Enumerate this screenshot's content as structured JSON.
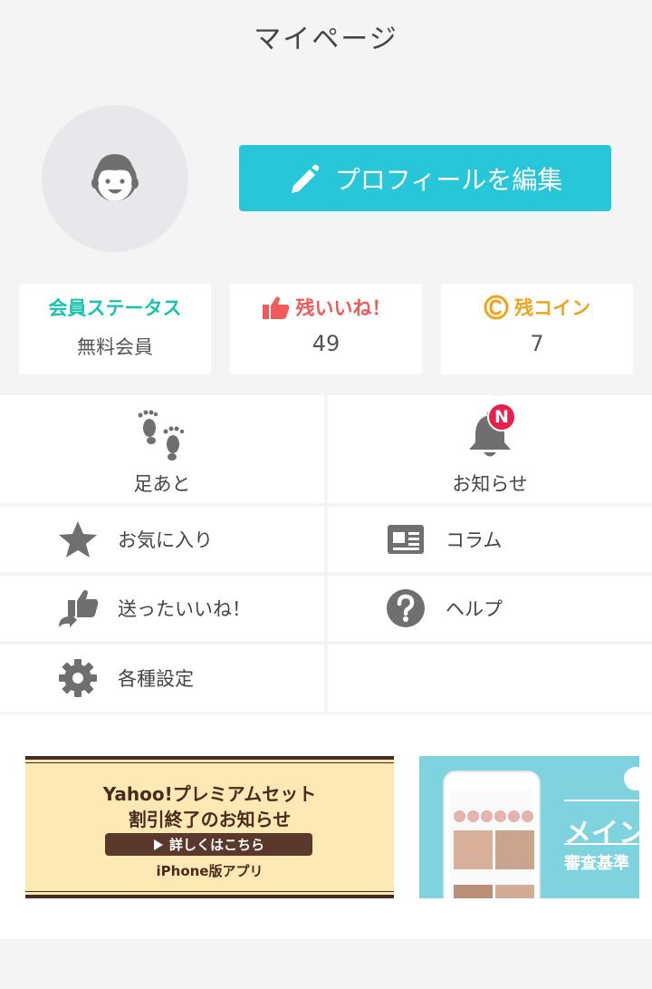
{
  "header": {
    "title": "マイページ"
  },
  "profile": {
    "edit_label": "プロフィールを編集"
  },
  "stats": [
    {
      "title": "会員ステータス",
      "value": "無料会員",
      "color": "#19c3b0"
    },
    {
      "title": "残いいね！",
      "value": "49",
      "color": "#f05a5a"
    },
    {
      "title": "残コイン",
      "value": "7",
      "color": "#f3a21b"
    }
  ],
  "menu": {
    "footprints": {
      "label": "足あと",
      "icon": "footprints-icon"
    },
    "notices": {
      "label": "お知らせ",
      "icon": "bell-icon",
      "badge": "N"
    },
    "favorites": {
      "label": "お気に入り",
      "icon": "star-icon"
    },
    "column": {
      "label": "コラム",
      "icon": "newspaper-icon"
    },
    "sent_likes": {
      "label": "送ったいいね！",
      "icon": "thumbs-up-send-icon"
    },
    "help": {
      "label": "ヘルプ",
      "icon": "help-icon"
    },
    "settings": {
      "label": "各種設定",
      "icon": "gear-icon"
    }
  },
  "banners": {
    "yahoo": {
      "line1": "Yahoo!プレミアムセット",
      "line2": "割引終了のお知らせ",
      "button": "詳しくはこちら",
      "line3": "iPhone版アプリ"
    },
    "main": {
      "title": "メイン",
      "subtitle": "審査基準"
    }
  }
}
